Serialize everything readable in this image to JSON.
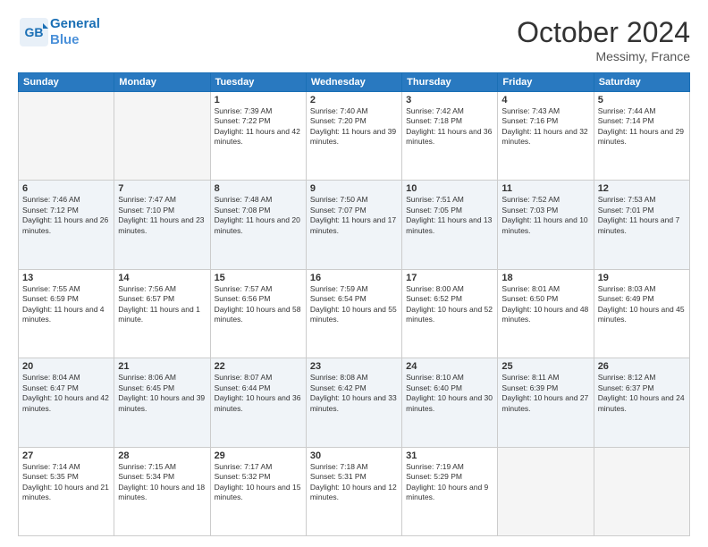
{
  "header": {
    "logo_line1": "General",
    "logo_line2": "Blue",
    "month": "October 2024",
    "location": "Messimy, France"
  },
  "weekdays": [
    "Sunday",
    "Monday",
    "Tuesday",
    "Wednesday",
    "Thursday",
    "Friday",
    "Saturday"
  ],
  "weeks": [
    [
      {
        "day": "",
        "sunrise": "",
        "sunset": "",
        "daylight": "",
        "empty": true
      },
      {
        "day": "",
        "sunrise": "",
        "sunset": "",
        "daylight": "",
        "empty": true
      },
      {
        "day": "1",
        "sunrise": "Sunrise: 7:39 AM",
        "sunset": "Sunset: 7:22 PM",
        "daylight": "Daylight: 11 hours and 42 minutes.",
        "empty": false
      },
      {
        "day": "2",
        "sunrise": "Sunrise: 7:40 AM",
        "sunset": "Sunset: 7:20 PM",
        "daylight": "Daylight: 11 hours and 39 minutes.",
        "empty": false
      },
      {
        "day": "3",
        "sunrise": "Sunrise: 7:42 AM",
        "sunset": "Sunset: 7:18 PM",
        "daylight": "Daylight: 11 hours and 36 minutes.",
        "empty": false
      },
      {
        "day": "4",
        "sunrise": "Sunrise: 7:43 AM",
        "sunset": "Sunset: 7:16 PM",
        "daylight": "Daylight: 11 hours and 32 minutes.",
        "empty": false
      },
      {
        "day": "5",
        "sunrise": "Sunrise: 7:44 AM",
        "sunset": "Sunset: 7:14 PM",
        "daylight": "Daylight: 11 hours and 29 minutes.",
        "empty": false
      }
    ],
    [
      {
        "day": "6",
        "sunrise": "Sunrise: 7:46 AM",
        "sunset": "Sunset: 7:12 PM",
        "daylight": "Daylight: 11 hours and 26 minutes.",
        "empty": false
      },
      {
        "day": "7",
        "sunrise": "Sunrise: 7:47 AM",
        "sunset": "Sunset: 7:10 PM",
        "daylight": "Daylight: 11 hours and 23 minutes.",
        "empty": false
      },
      {
        "day": "8",
        "sunrise": "Sunrise: 7:48 AM",
        "sunset": "Sunset: 7:08 PM",
        "daylight": "Daylight: 11 hours and 20 minutes.",
        "empty": false
      },
      {
        "day": "9",
        "sunrise": "Sunrise: 7:50 AM",
        "sunset": "Sunset: 7:07 PM",
        "daylight": "Daylight: 11 hours and 17 minutes.",
        "empty": false
      },
      {
        "day": "10",
        "sunrise": "Sunrise: 7:51 AM",
        "sunset": "Sunset: 7:05 PM",
        "daylight": "Daylight: 11 hours and 13 minutes.",
        "empty": false
      },
      {
        "day": "11",
        "sunrise": "Sunrise: 7:52 AM",
        "sunset": "Sunset: 7:03 PM",
        "daylight": "Daylight: 11 hours and 10 minutes.",
        "empty": false
      },
      {
        "day": "12",
        "sunrise": "Sunrise: 7:53 AM",
        "sunset": "Sunset: 7:01 PM",
        "daylight": "Daylight: 11 hours and 7 minutes.",
        "empty": false
      }
    ],
    [
      {
        "day": "13",
        "sunrise": "Sunrise: 7:55 AM",
        "sunset": "Sunset: 6:59 PM",
        "daylight": "Daylight: 11 hours and 4 minutes.",
        "empty": false
      },
      {
        "day": "14",
        "sunrise": "Sunrise: 7:56 AM",
        "sunset": "Sunset: 6:57 PM",
        "daylight": "Daylight: 11 hours and 1 minute.",
        "empty": false
      },
      {
        "day": "15",
        "sunrise": "Sunrise: 7:57 AM",
        "sunset": "Sunset: 6:56 PM",
        "daylight": "Daylight: 10 hours and 58 minutes.",
        "empty": false
      },
      {
        "day": "16",
        "sunrise": "Sunrise: 7:59 AM",
        "sunset": "Sunset: 6:54 PM",
        "daylight": "Daylight: 10 hours and 55 minutes.",
        "empty": false
      },
      {
        "day": "17",
        "sunrise": "Sunrise: 8:00 AM",
        "sunset": "Sunset: 6:52 PM",
        "daylight": "Daylight: 10 hours and 52 minutes.",
        "empty": false
      },
      {
        "day": "18",
        "sunrise": "Sunrise: 8:01 AM",
        "sunset": "Sunset: 6:50 PM",
        "daylight": "Daylight: 10 hours and 48 minutes.",
        "empty": false
      },
      {
        "day": "19",
        "sunrise": "Sunrise: 8:03 AM",
        "sunset": "Sunset: 6:49 PM",
        "daylight": "Daylight: 10 hours and 45 minutes.",
        "empty": false
      }
    ],
    [
      {
        "day": "20",
        "sunrise": "Sunrise: 8:04 AM",
        "sunset": "Sunset: 6:47 PM",
        "daylight": "Daylight: 10 hours and 42 minutes.",
        "empty": false
      },
      {
        "day": "21",
        "sunrise": "Sunrise: 8:06 AM",
        "sunset": "Sunset: 6:45 PM",
        "daylight": "Daylight: 10 hours and 39 minutes.",
        "empty": false
      },
      {
        "day": "22",
        "sunrise": "Sunrise: 8:07 AM",
        "sunset": "Sunset: 6:44 PM",
        "daylight": "Daylight: 10 hours and 36 minutes.",
        "empty": false
      },
      {
        "day": "23",
        "sunrise": "Sunrise: 8:08 AM",
        "sunset": "Sunset: 6:42 PM",
        "daylight": "Daylight: 10 hours and 33 minutes.",
        "empty": false
      },
      {
        "day": "24",
        "sunrise": "Sunrise: 8:10 AM",
        "sunset": "Sunset: 6:40 PM",
        "daylight": "Daylight: 10 hours and 30 minutes.",
        "empty": false
      },
      {
        "day": "25",
        "sunrise": "Sunrise: 8:11 AM",
        "sunset": "Sunset: 6:39 PM",
        "daylight": "Daylight: 10 hours and 27 minutes.",
        "empty": false
      },
      {
        "day": "26",
        "sunrise": "Sunrise: 8:12 AM",
        "sunset": "Sunset: 6:37 PM",
        "daylight": "Daylight: 10 hours and 24 minutes.",
        "empty": false
      }
    ],
    [
      {
        "day": "27",
        "sunrise": "Sunrise: 7:14 AM",
        "sunset": "Sunset: 5:35 PM",
        "daylight": "Daylight: 10 hours and 21 minutes.",
        "empty": false
      },
      {
        "day": "28",
        "sunrise": "Sunrise: 7:15 AM",
        "sunset": "Sunset: 5:34 PM",
        "daylight": "Daylight: 10 hours and 18 minutes.",
        "empty": false
      },
      {
        "day": "29",
        "sunrise": "Sunrise: 7:17 AM",
        "sunset": "Sunset: 5:32 PM",
        "daylight": "Daylight: 10 hours and 15 minutes.",
        "empty": false
      },
      {
        "day": "30",
        "sunrise": "Sunrise: 7:18 AM",
        "sunset": "Sunset: 5:31 PM",
        "daylight": "Daylight: 10 hours and 12 minutes.",
        "empty": false
      },
      {
        "day": "31",
        "sunrise": "Sunrise: 7:19 AM",
        "sunset": "Sunset: 5:29 PM",
        "daylight": "Daylight: 10 hours and 9 minutes.",
        "empty": false
      },
      {
        "day": "",
        "sunrise": "",
        "sunset": "",
        "daylight": "",
        "empty": true
      },
      {
        "day": "",
        "sunrise": "",
        "sunset": "",
        "daylight": "",
        "empty": true
      }
    ]
  ]
}
